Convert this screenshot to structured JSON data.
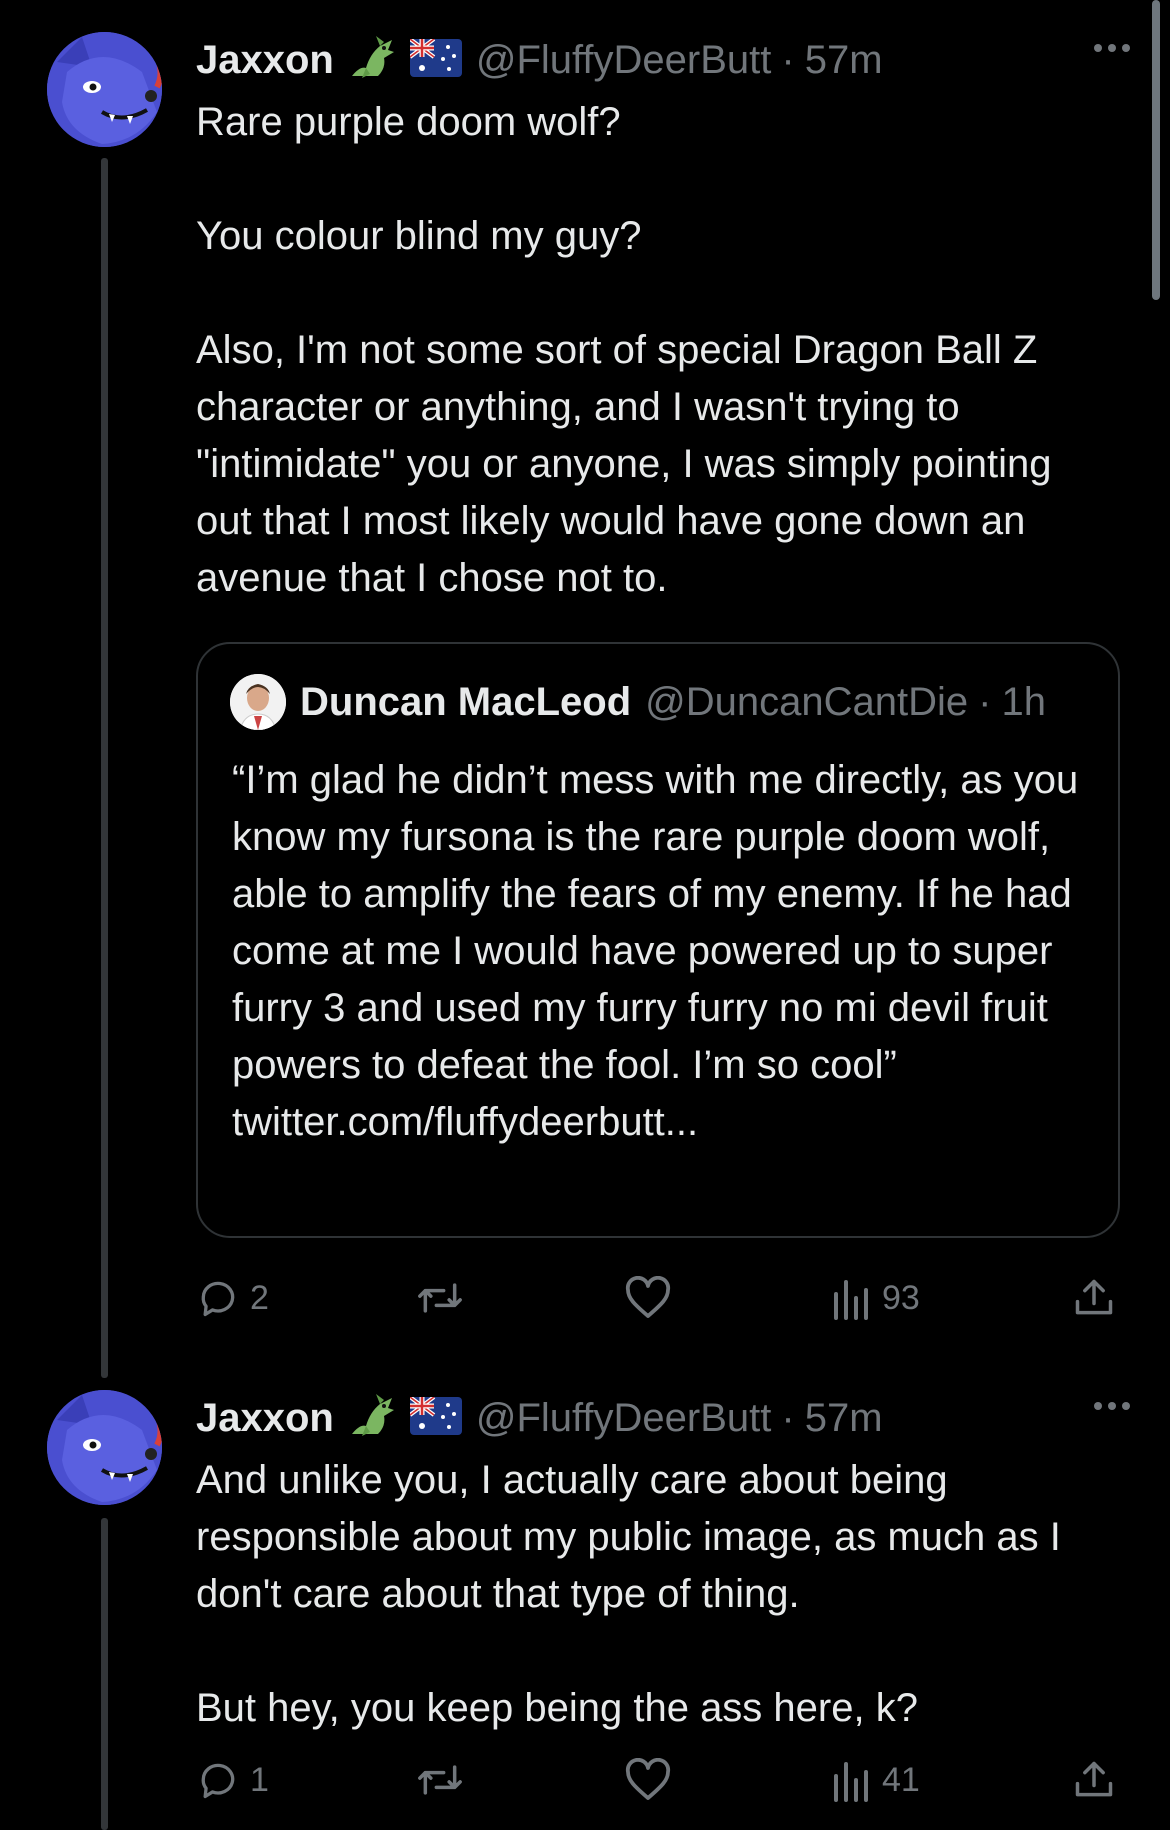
{
  "tweets": [
    {
      "display_name": "Jaxxon",
      "handle": "@FluffyDeerButt",
      "separator": "·",
      "time": "57m",
      "text": "Rare purple doom wolf?\n\nYou colour blind my guy?\n\nAlso, I'm not some sort of special Dragon Ball Z character or anything, and I wasn't trying to \"intimidate\" you or anyone, I was simply pointing out that I most likely would have gone down an avenue that I chose not to.",
      "quote": {
        "display_name": "Duncan MacLeod",
        "handle": "@DuncanCantDie",
        "separator": "·",
        "time": "1h",
        "text": "“I’m glad he didn’t mess with me directly, as you know my fursona is the rare purple doom wolf, able to amplify the fears of my enemy. If he had come at me I would have powered up to super furry 3 and used my furry furry no mi devil fruit powers to defeat the fool. I’m so cool”\ntwitter.com/fluffydeerbutt..."
      },
      "reply_count": "2",
      "views": "93"
    },
    {
      "display_name": "Jaxxon",
      "handle": "@FluffyDeerButt",
      "separator": "·",
      "time": "57m",
      "text": "And unlike you, I actually care about being responsible about my public image, as much as I don't care about that type of thing.\n\nBut hey, you keep being the ass here, k?",
      "reply_count": "1",
      "views": "41"
    }
  ],
  "icons": {
    "badge_1": "green-dragon-icon",
    "badge_2": "australia-flag-icon",
    "more": "more-dots-icon",
    "reply": "reply-icon",
    "retweet": "retweet-icon",
    "like": "heart-icon",
    "views": "views-icon",
    "share": "share-icon"
  },
  "colors": {
    "background": "#000000",
    "text_primary": "#e7e9ea",
    "text_secondary": "#71767b",
    "border": "#2f3336",
    "avatar_purple": "#4a4fd0"
  }
}
